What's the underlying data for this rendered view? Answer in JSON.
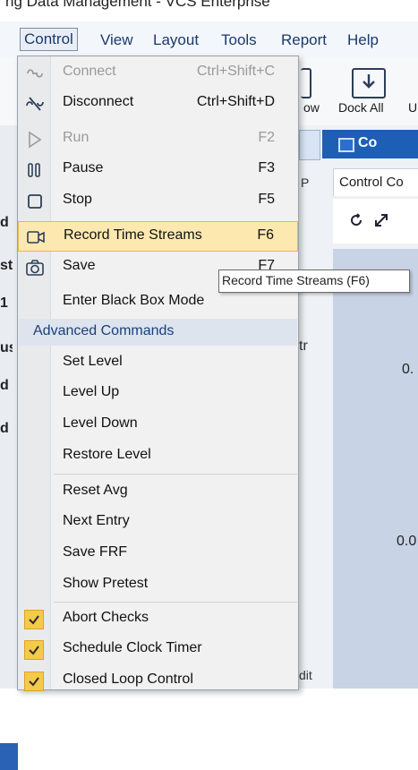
{
  "window": {
    "title": "ng Data Management - VCS Enterprise"
  },
  "menubar": {
    "items": [
      {
        "label": "Control",
        "active": true
      },
      {
        "label": "View"
      },
      {
        "label": "Layout"
      },
      {
        "label": "Tools"
      },
      {
        "label": "Report"
      },
      {
        "label": "Help"
      }
    ]
  },
  "toolbar": {
    "dock_all_label": "Dock All",
    "ow_label": "ow",
    "u_label": "U"
  },
  "background": {
    "left_chips": [
      "d",
      "st",
      "1",
      "us",
      "d",
      "d"
    ],
    "doc_tab_label": "Co",
    "subtab_label": "Control Co",
    "y_labels": [
      "0.",
      "0.0"
    ],
    "behind_labels": {
      "p": "P",
      "tr": "tr",
      "dit": "dit"
    }
  },
  "menu": {
    "items": [
      {
        "label": "Connect",
        "shortcut": "Ctrl+Shift+C",
        "icon": "connect-icon",
        "disabled": true
      },
      {
        "label": "Disconnect",
        "shortcut": "Ctrl+Shift+D",
        "icon": "disconnect-icon"
      },
      {
        "label": "Run",
        "shortcut": "F2",
        "icon": "play-icon",
        "disabled": true
      },
      {
        "label": "Pause",
        "shortcut": "F3",
        "icon": "pause-icon"
      },
      {
        "label": "Stop",
        "shortcut": "F5",
        "icon": "stop-icon"
      },
      {
        "label": "Record Time Streams",
        "shortcut": "F6",
        "icon": "record-icon",
        "highlighted": true
      },
      {
        "label": "Save",
        "shortcut": "F7",
        "icon": "camera-icon"
      },
      {
        "label": "Enter Black Box Mode",
        "shortcut": ""
      }
    ],
    "section_label": "Advanced Commands",
    "advanced": [
      {
        "label": "Set Level"
      },
      {
        "label": "Level Up"
      },
      {
        "label": "Level Down"
      },
      {
        "label": "Restore Level"
      },
      {
        "label": "Reset Avg"
      },
      {
        "label": "Next Entry"
      },
      {
        "label": "Save FRF"
      },
      {
        "label": "Show Pretest"
      }
    ],
    "checked": [
      {
        "label": "Abort Checks",
        "checked": true
      },
      {
        "label": "Schedule Clock Timer",
        "checked": true
      },
      {
        "label": "Closed Loop Control",
        "checked": true
      }
    ]
  },
  "tooltip": {
    "text": "Record Time Streams (F6)"
  },
  "colors": {
    "accent": "#1e5fb6",
    "highlight": "#fde9b0",
    "check": "#f5c94a",
    "section_text": "#1c3f78"
  }
}
